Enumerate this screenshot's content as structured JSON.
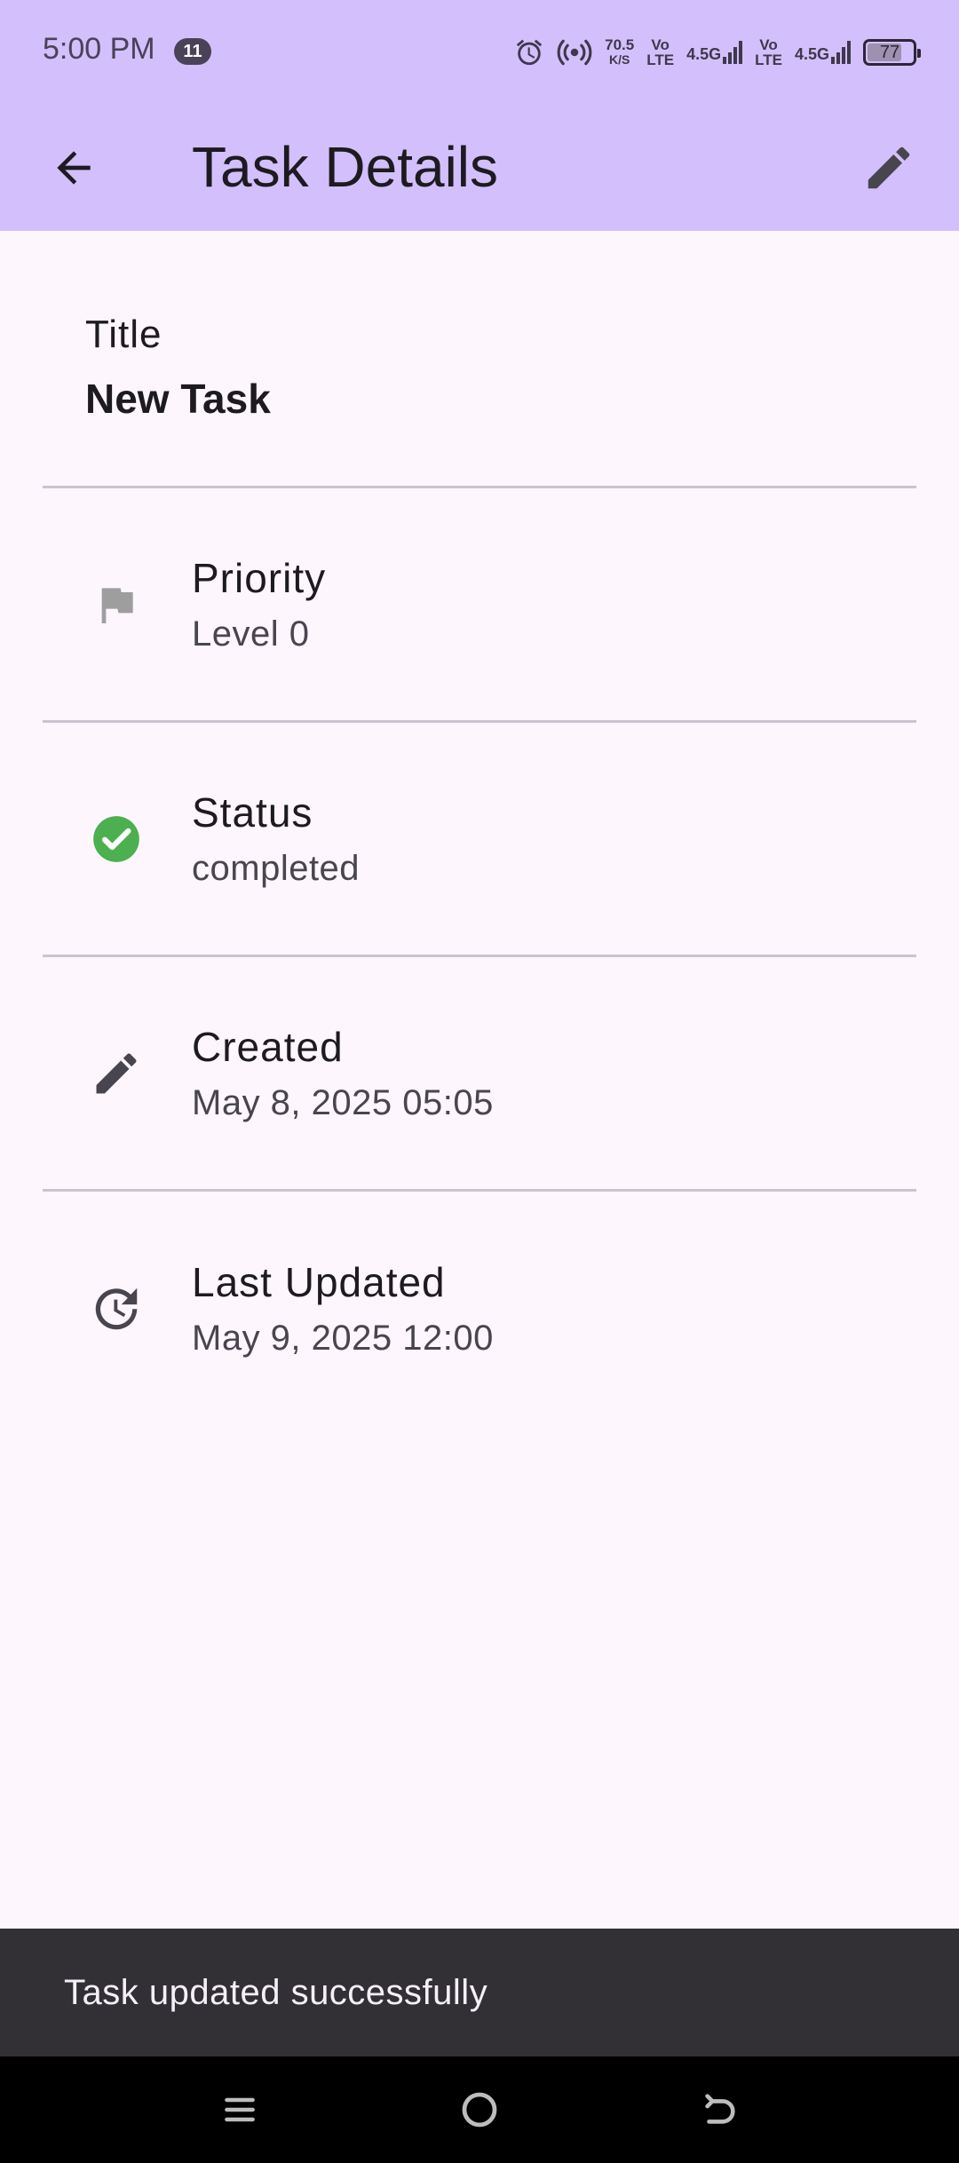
{
  "status_bar": {
    "time": "5:00 PM",
    "notification_count": "11",
    "speed_value": "70.5",
    "speed_unit": "K/S",
    "sim1_top": "Vo",
    "sim1_bottom": "LTE",
    "sim1_network": "4.5G",
    "sim2_top": "Vo",
    "sim2_bottom": "LTE",
    "sim2_network": "4.5G",
    "battery_level": "77",
    "battery_fraction": 0.77,
    "icons": [
      "alarm-icon",
      "hotspot-icon",
      "signal-icon",
      "battery-icon"
    ]
  },
  "app_bar": {
    "title": "Task Details",
    "back_icon": "arrow-back-icon",
    "edit_icon": "edit-icon",
    "background": "#d3bffc"
  },
  "task": {
    "title_label": "Title",
    "title_value": "New Task",
    "rows": [
      {
        "icon": "flag-icon",
        "label": "Priority",
        "value": "Level 0"
      },
      {
        "icon": "check-circle-icon",
        "label": "Status",
        "value": "completed",
        "icon_color": "#4caf50"
      },
      {
        "icon": "pencil-icon",
        "label": "Created",
        "value": "May 8, 2025 05:05"
      },
      {
        "icon": "update-icon",
        "label": "Last Updated",
        "value": "May 9, 2025 12:00"
      }
    ]
  },
  "snackbar": {
    "message": "Task updated successfully"
  },
  "nav_bar": {
    "buttons": [
      "menu-icon",
      "home-icon",
      "back-icon"
    ]
  }
}
